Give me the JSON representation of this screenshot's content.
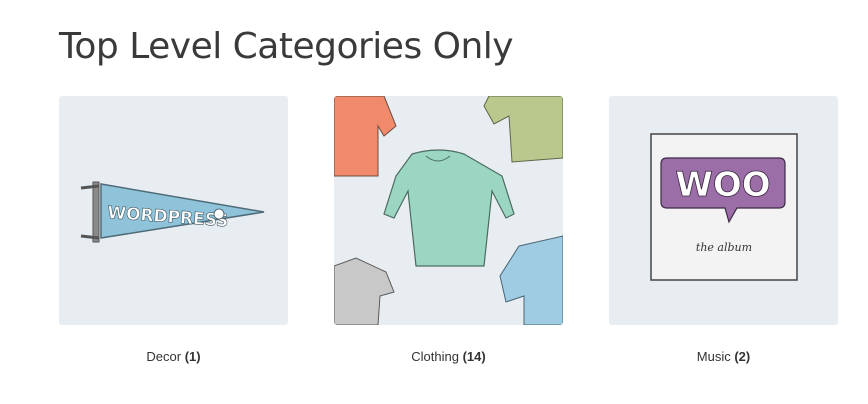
{
  "page": {
    "title": "Top Level Categories Only"
  },
  "categories": [
    {
      "name": "Decor",
      "count": "(1)",
      "image_icon": "wordpress-pennant-icon",
      "pennant_text": "WORDPRESS"
    },
    {
      "name": "Clothing",
      "count": "(14)",
      "image_icon": "clothing-collage-icon"
    },
    {
      "name": "Music",
      "count": "(2)",
      "image_icon": "woo-album-icon",
      "album_logo": "WOO",
      "album_subtitle": "the album"
    }
  ],
  "colors": {
    "thumb_background": "#e8edf2",
    "pennant_blue": "#8fc3d9",
    "woo_purple": "#9b6ea8",
    "shirt_orange": "#f08a6a",
    "shirt_green": "#b9c98e",
    "shirt_teal": "#9ad6c1",
    "shirt_grey": "#c8c8c8",
    "shirt_blue": "#9fcbe3"
  }
}
